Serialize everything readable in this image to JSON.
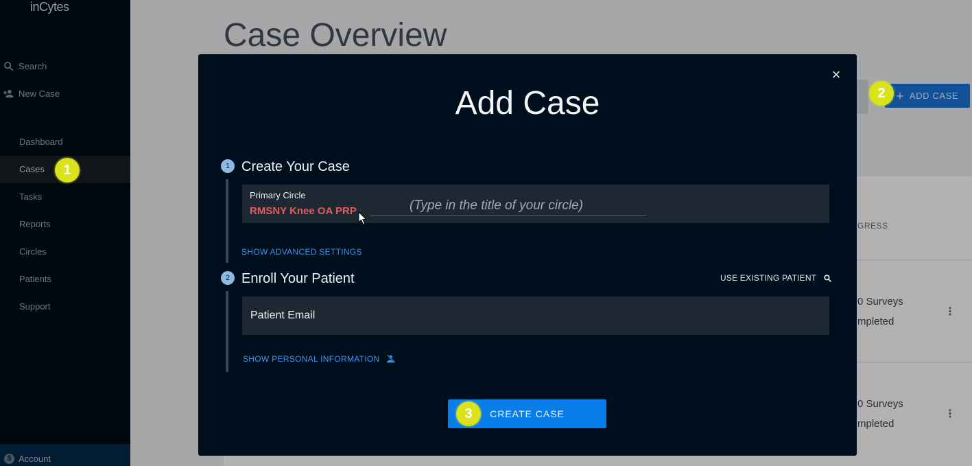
{
  "sidebar": {
    "logo": "inCytes",
    "search_label": "Search",
    "new_case_label": "New Case",
    "nav_items": [
      {
        "label": "Dashboard"
      },
      {
        "label": "Cases"
      },
      {
        "label": "Tasks"
      },
      {
        "label": "Reports"
      },
      {
        "label": "Circles"
      },
      {
        "label": "Patients"
      },
      {
        "label": "Support"
      }
    ],
    "active_item": "Cases",
    "account_label": "Account"
  },
  "main": {
    "page_title": "Case Overview",
    "add_case_label": "ADD CASE",
    "progress_header": "GRESS",
    "rows": [
      {
        "surveys_line1": "0 Surveys",
        "surveys_line2": "mpleted"
      },
      {
        "surveys_line1": "0 Surveys",
        "surveys_line2": "mpleted"
      }
    ]
  },
  "modal": {
    "title": "Add Case",
    "close_symbol": "×",
    "step1": {
      "number": "1",
      "title": "Create Your Case",
      "field_label": "Primary Circle",
      "field_value": "RMSNY Knee OA PRP",
      "field_hint": "(Type in the title of your circle)",
      "advanced_link": "SHOW ADVANCED SETTINGS"
    },
    "step2": {
      "number": "2",
      "title": "Enroll Your Patient",
      "use_existing": "USE EXISTING PATIENT",
      "email_label": "Patient Email",
      "personal_link": "SHOW PERSONAL INFORMATION"
    },
    "create_label": "CREATE CASE"
  },
  "markers": [
    "1",
    "2",
    "3"
  ],
  "colors": {
    "sidebar_bg": "#000c16",
    "modal_bg": "#000f1e",
    "accent_blue": "#0a7ee8",
    "link_blue": "#3f94ea",
    "marker_yellow": "#d9e21a",
    "value_red": "#e35d5d"
  }
}
